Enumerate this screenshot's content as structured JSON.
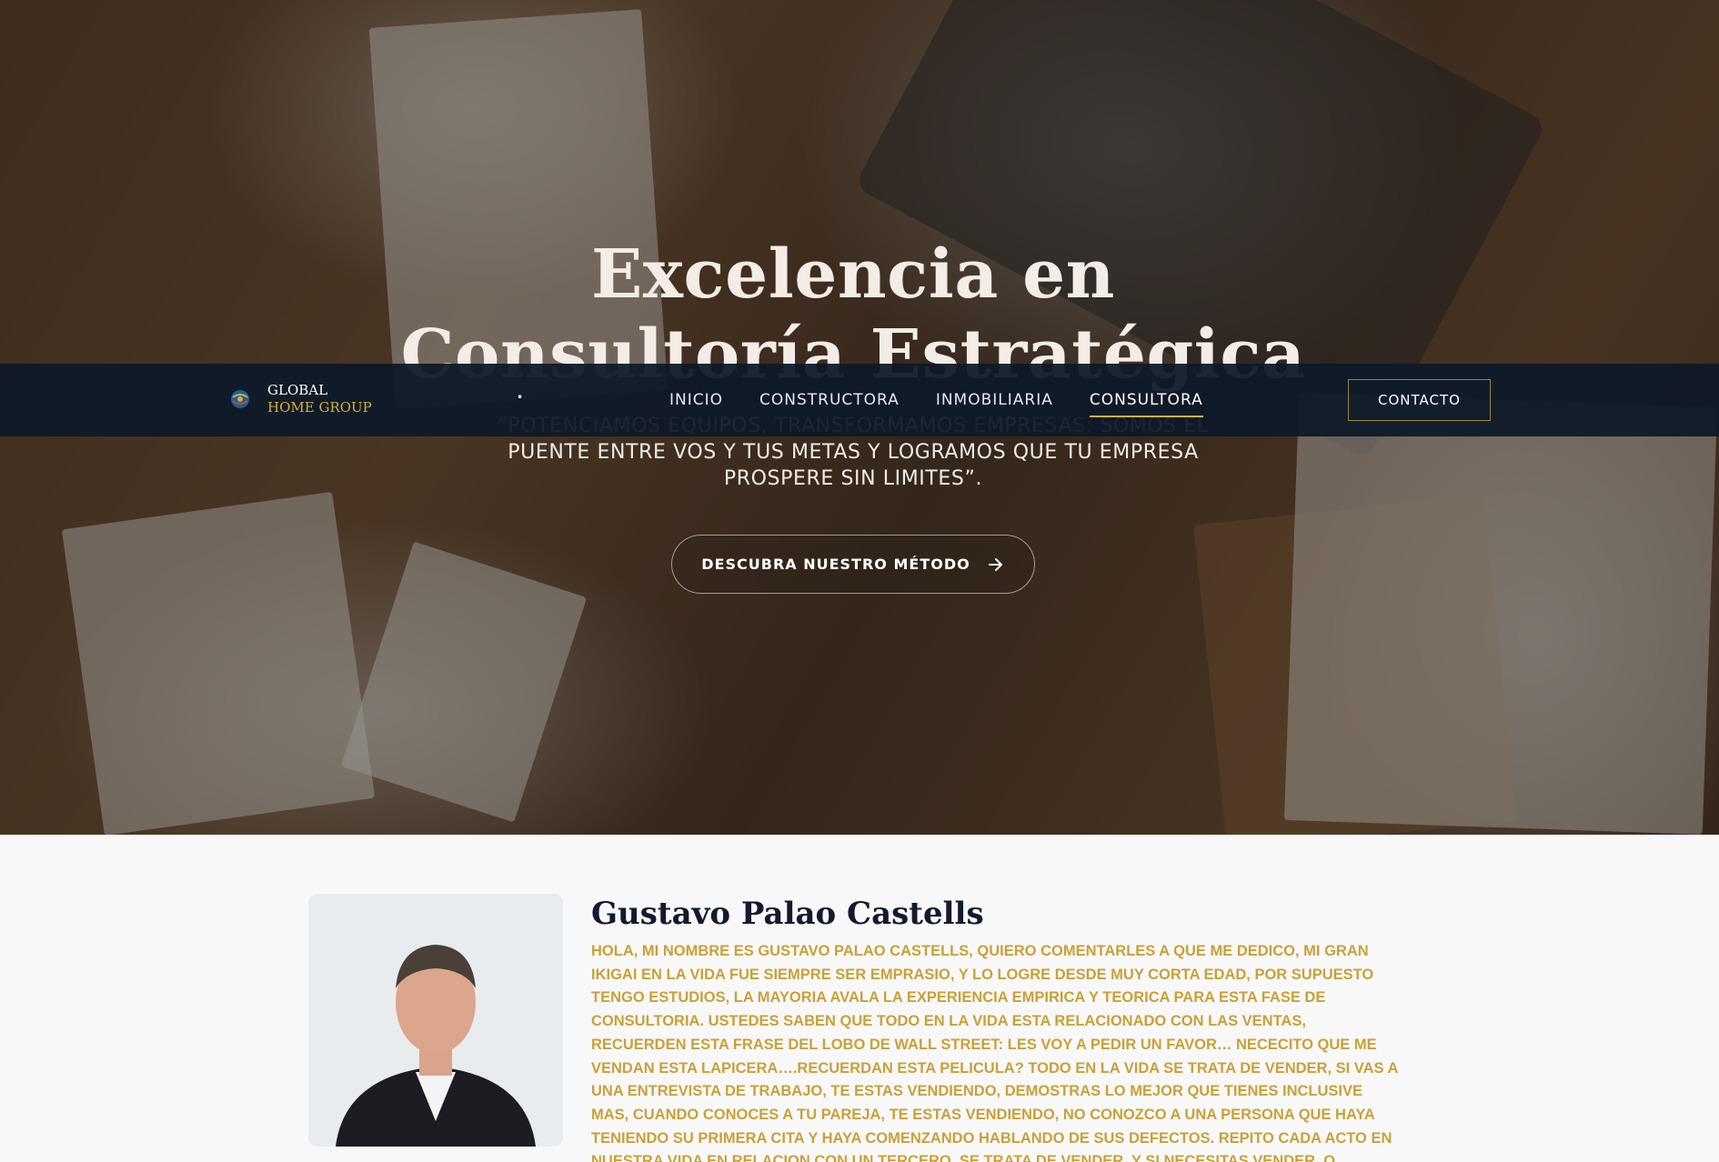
{
  "brand": {
    "line1": "GLOBAL",
    "line2": "HOME GROUP",
    "colors": {
      "navy": "#0e1828",
      "gold": "#d4af37",
      "text_gold": "#c9a13a"
    }
  },
  "hero": {
    "title": "Excelencia en Consultoría Estratégica",
    "subtitle": "“POTENCIAMOS EQUIPOS, TRANSFORMAMOS EMPRESAS: SOMOS EL PUENTE ENTRE VOS Y TUS METAS Y LOGRAMOS QUE TU EMPRESA PROSPERE SIN LIMITES”.",
    "cta_label": "DESCUBRA NUESTRO MÉTODO",
    "cta_icon": "arrow-right-icon"
  },
  "nav": {
    "dot": "•",
    "items": [
      {
        "label": "INICIO"
      },
      {
        "label": "CONSTRUCTORA"
      },
      {
        "label": "INMOBILIARIA"
      },
      {
        "label": "CONSULTORA",
        "active": true
      }
    ],
    "contact_label": "CONTACTO"
  },
  "about": {
    "name": "Gustavo Palao Castells",
    "body": "HOLA, MI NOMBRE ES GUSTAVO PALAO CASTELLS, QUIERO COMENTARLES A QUE ME DEDICO, MI GRAN IKIGAI EN LA VIDA FUE SIEMPRE SER EMPRASIO, Y LO LOGRE DESDE MUY CORTA EDAD, POR SUPUESTO TENGO ESTUDIOS, LA MAYORIA AVALA LA EXPERIENCIA EMPIRICA Y TEORICA PARA ESTA FASE DE CONSULTORIA. USTEDES SABEN QUE TODO EN LA VIDA ESTA RELACIONADO CON LAS VENTAS, RECUERDEN ESTA FRASE DEL LOBO DE WALL STREET: les voy a pedir un favor… NECECITO QUE ME VENDAN ESTA LAPICERA….RECUERDAN ESTA PELICULA? TODO EN LA VIDA SE TRATA DE VENDER, SI VAS A UNA ENTREVISTA DE TRABAJO, TE ESTAS VENDIENDO, DEMOSTRAS LO MEJOR QUE TIENES INCLUSIVE MAS, CUANDO CONOCES A TU PAREJA, TE ESTAS VENDIENDO, NO CONOZCO A UNA PERSONA QUE HAYA TENIENDO SU PRIMERA CITA Y HAYA COMENZANDO HABLANDO DE SUS DEFECTOS. REPITO CADA ACTO EN NUESTRA VIDA EN RELACION CON UN TERCERO, SE TRATA DE VENDER, Y SI NECESITAS VENDER, O VENDERTE, SOLO TIENES QUE DESCRIBIR CUAL ES LA"
  }
}
